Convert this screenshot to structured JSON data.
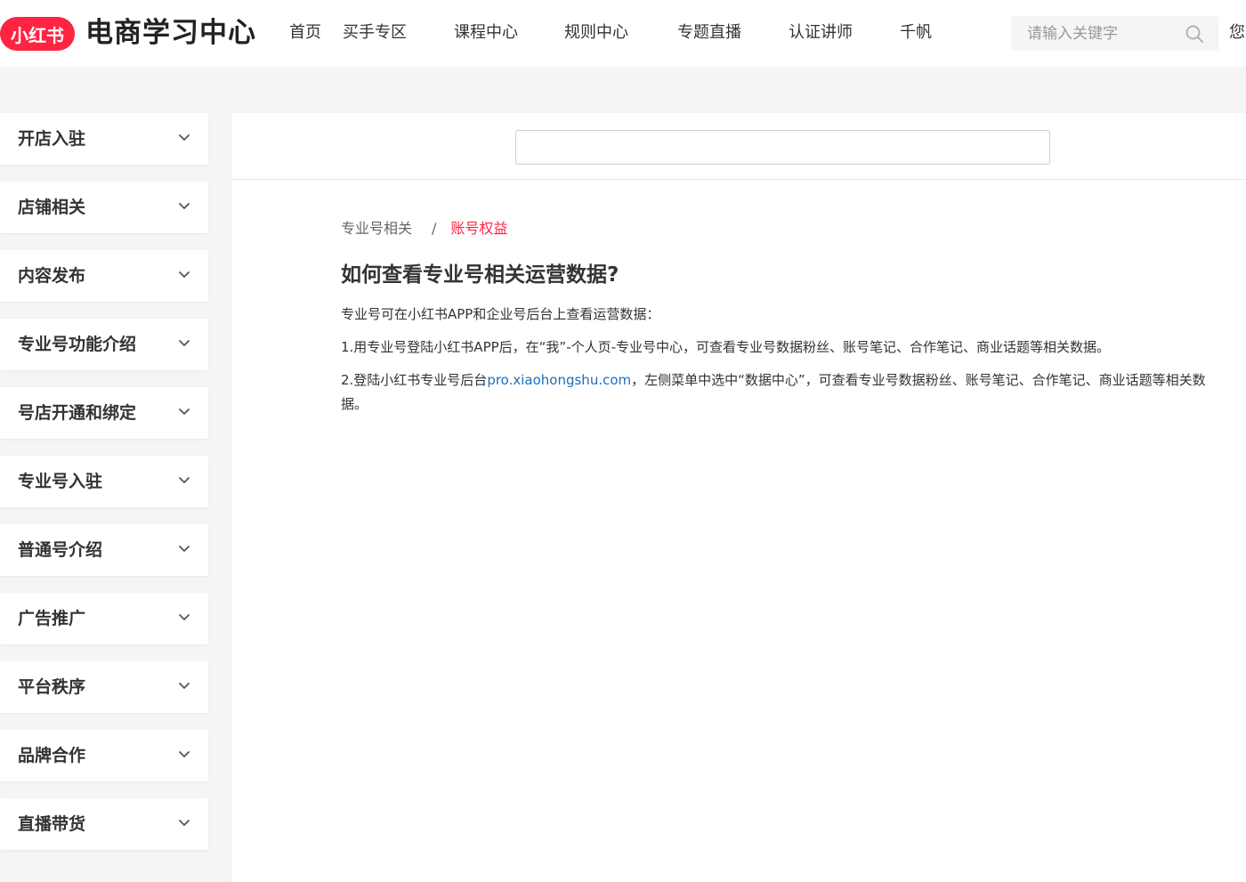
{
  "header": {
    "logo_text": "小红书",
    "title": "电商学习中心",
    "nav": [
      "首页",
      "买手专区",
      "课程中心",
      "规则中心",
      "专题直播",
      "认证讲师",
      "千帆"
    ],
    "search_placeholder": "请输入关键字",
    "cut_text": "您"
  },
  "sidebar": {
    "items": [
      "开店入驻",
      "店铺相关",
      "内容发布",
      "专业号功能介绍",
      "号店开通和绑定",
      "专业号入驻",
      "普通号介绍",
      "广告推广",
      "平台秩序",
      "品牌合作",
      "直播带货"
    ]
  },
  "main": {
    "search_value": "",
    "breadcrumb": {
      "parent": "专业号相关",
      "separator": "/",
      "current": "账号权益"
    },
    "title": "如何查看专业号相关运营数据?",
    "intro": "专业号可在小红书APP和企业号后台上查看运营数据：",
    "step1": "1.用专业号登陆小红书APP后，在“我”-个人页-专业号中心，可查看专业号数据粉丝、账号笔记、合作笔记、商业话题等相关数据。",
    "step2_prefix": "2.登陆小红书专业号后台",
    "step2_link": "pro.xiaohongshu.com",
    "step2_suffix": "，左侧菜单中选中“数据中心”，可查看专业号数据粉丝、账号笔记、合作笔记、商业话题等相关数据。"
  },
  "colors": {
    "brand": "#ff2442",
    "link": "#1d6fb8",
    "page_bg": "#f5f5f5"
  },
  "icons": {
    "search": "search-icon",
    "chevron": "chevron-down-icon"
  }
}
